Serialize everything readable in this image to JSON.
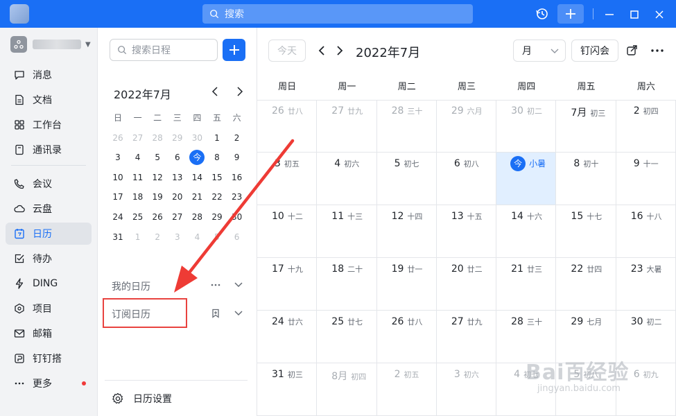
{
  "titlebar": {
    "search_placeholder": "搜索"
  },
  "nav": {
    "items": [
      {
        "label": "消息"
      },
      {
        "label": "文档"
      },
      {
        "label": "工作台"
      },
      {
        "label": "通讯录"
      },
      {
        "label": "会议"
      },
      {
        "label": "云盘"
      },
      {
        "label": "日历"
      },
      {
        "label": "待办"
      },
      {
        "label": "DING"
      },
      {
        "label": "项目"
      },
      {
        "label": "邮箱"
      },
      {
        "label": "钉钉搭"
      },
      {
        "label": "更多"
      }
    ],
    "active": "日历"
  },
  "side": {
    "search_placeholder": "搜索日程",
    "mini_title": "2022年7月",
    "weekdays": [
      "日",
      "一",
      "二",
      "三",
      "四",
      "五",
      "六"
    ],
    "weeks": [
      [
        "26",
        "27",
        "28",
        "29",
        "30",
        "1",
        "2"
      ],
      [
        "3",
        "4",
        "5",
        "6",
        "今",
        "8",
        "9"
      ],
      [
        "10",
        "11",
        "12",
        "13",
        "14",
        "15",
        "16"
      ],
      [
        "17",
        "18",
        "19",
        "20",
        "21",
        "22",
        "23"
      ],
      [
        "24",
        "25",
        "26",
        "27",
        "28",
        "29",
        "30"
      ],
      [
        "31",
        "1",
        "2",
        "3",
        "4",
        "5",
        "6"
      ]
    ],
    "my_calendar": "我的日历",
    "subscribed_calendar": "订阅日历",
    "settings": "日历设置"
  },
  "main": {
    "today_button": "今天",
    "title": "2022年7月",
    "view": "月",
    "flash_button": "钉闪会",
    "week_headers": [
      "周日",
      "周一",
      "周二",
      "周三",
      "周四",
      "周五",
      "周六"
    ],
    "cells": [
      [
        {
          "d": "26",
          "l": "廿八"
        },
        {
          "d": "27",
          "l": "廿九"
        },
        {
          "d": "28",
          "l": "三十"
        },
        {
          "d": "29",
          "l": "六月"
        },
        {
          "d": "30",
          "l": "初二"
        },
        {
          "d": "7月",
          "l": "初三"
        },
        {
          "d": "2",
          "l": "初四"
        }
      ],
      [
        {
          "d": "3",
          "l": "初五"
        },
        {
          "d": "4",
          "l": "初六"
        },
        {
          "d": "5",
          "l": "初七"
        },
        {
          "d": "6",
          "l": "初八"
        },
        {
          "d": "今",
          "l": "小暑"
        },
        {
          "d": "8",
          "l": "初十"
        },
        {
          "d": "9",
          "l": "十一"
        }
      ],
      [
        {
          "d": "10",
          "l": "十二"
        },
        {
          "d": "11",
          "l": "十三"
        },
        {
          "d": "12",
          "l": "十四"
        },
        {
          "d": "13",
          "l": "十五"
        },
        {
          "d": "14",
          "l": "十六"
        },
        {
          "d": "15",
          "l": "十七"
        },
        {
          "d": "16",
          "l": "十八"
        }
      ],
      [
        {
          "d": "17",
          "l": "十九"
        },
        {
          "d": "18",
          "l": "二十"
        },
        {
          "d": "19",
          "l": "廿一"
        },
        {
          "d": "20",
          "l": "廿二"
        },
        {
          "d": "21",
          "l": "廿三"
        },
        {
          "d": "22",
          "l": "廿四"
        },
        {
          "d": "23",
          "l": "大暑"
        }
      ],
      [
        {
          "d": "24",
          "l": "廿六"
        },
        {
          "d": "25",
          "l": "廿七"
        },
        {
          "d": "26",
          "l": "廿八"
        },
        {
          "d": "27",
          "l": "廿九"
        },
        {
          "d": "28",
          "l": "三十"
        },
        {
          "d": "29",
          "l": "七月"
        },
        {
          "d": "30",
          "l": "初二"
        }
      ],
      [
        {
          "d": "31",
          "l": "初三"
        },
        {
          "d": "8月",
          "l": "初四"
        },
        {
          "d": "2",
          "l": "初五"
        },
        {
          "d": "3",
          "l": "初六"
        },
        {
          "d": "4",
          "l": "初七"
        },
        {
          "d": "5",
          "l": "初八"
        },
        {
          "d": "6",
          "l": "初九"
        }
      ]
    ]
  },
  "watermark": {
    "text": "Bai百经验",
    "sub": "jingyan.baidu.com"
  },
  "colors": {
    "accent": "#1a6ff5",
    "highlight": "#e8423f",
    "today_bg": "#e1efff"
  }
}
